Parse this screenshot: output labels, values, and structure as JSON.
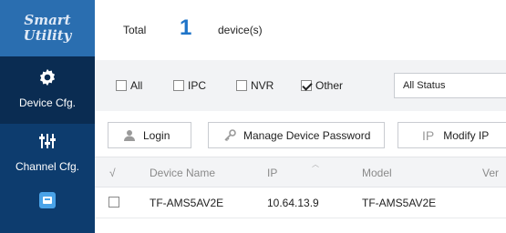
{
  "app": {
    "logo_line1": "Smart",
    "logo_line2": "Utility"
  },
  "sidebar": {
    "items": [
      {
        "label": "Device Cfg.",
        "icon": "gear-icon",
        "selected": true
      },
      {
        "label": "Channel Cfg.",
        "icon": "sliders-icon",
        "selected": false
      },
      {
        "label": "",
        "icon": "app-icon",
        "selected": false
      }
    ]
  },
  "summary": {
    "total_label": "Total",
    "count": "1",
    "unit_label": "device(s)"
  },
  "filter": {
    "checkboxes": [
      {
        "label": "All",
        "checked": false
      },
      {
        "label": "IPC",
        "checked": false
      },
      {
        "label": "NVR",
        "checked": false
      },
      {
        "label": "Other",
        "checked": true
      }
    ],
    "status_select": "All Status"
  },
  "toolbar": {
    "login_label": "Login",
    "modify_password_label": "Manage Device Password",
    "modify_ip_glyph": "IP",
    "modify_ip_label": "Modify IP"
  },
  "table": {
    "columns": {
      "select": "√",
      "name": "Device Name",
      "ip": "IP",
      "model": "Model",
      "version": "Ver"
    },
    "rows": [
      {
        "name": "TF-AMS5AV2E",
        "ip": "10.64.13.9",
        "model": "TF-AMS5AV2E",
        "selected": false
      }
    ]
  },
  "colors": {
    "sidebar": "#0d3c6e",
    "logo_bg": "#2a6eb0",
    "accent": "#1f74c8"
  }
}
